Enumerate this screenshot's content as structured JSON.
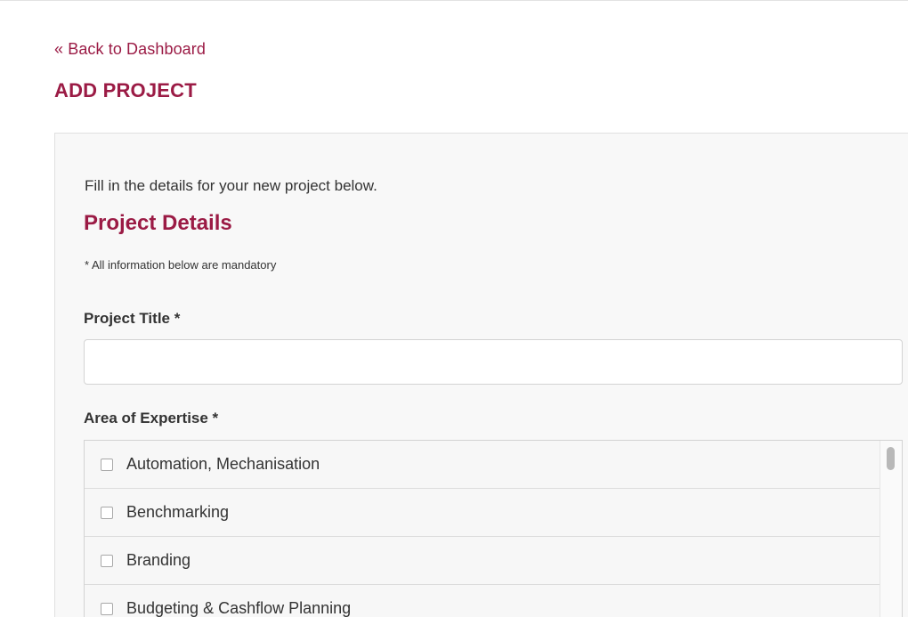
{
  "nav": {
    "back_link": "« Back to Dashboard"
  },
  "page": {
    "title": "ADD PROJECT"
  },
  "form": {
    "intro": "Fill in the details for your new project below.",
    "section_heading": "Project Details",
    "mandatory_note": "* All information below are mandatory",
    "project_title": {
      "label": "Project Title *",
      "value": "",
      "placeholder": ""
    },
    "area_of_expertise": {
      "label": "Area of Expertise *",
      "options": [
        {
          "label": "Automation, Mechanisation",
          "checked": false
        },
        {
          "label": "Benchmarking",
          "checked": false
        },
        {
          "label": "Branding",
          "checked": false
        },
        {
          "label": "Budgeting & Cashflow Planning",
          "checked": false
        }
      ]
    }
  },
  "colors": {
    "accent": "#9b1b45",
    "text": "#333333",
    "panel_background": "#f8f8f8"
  }
}
